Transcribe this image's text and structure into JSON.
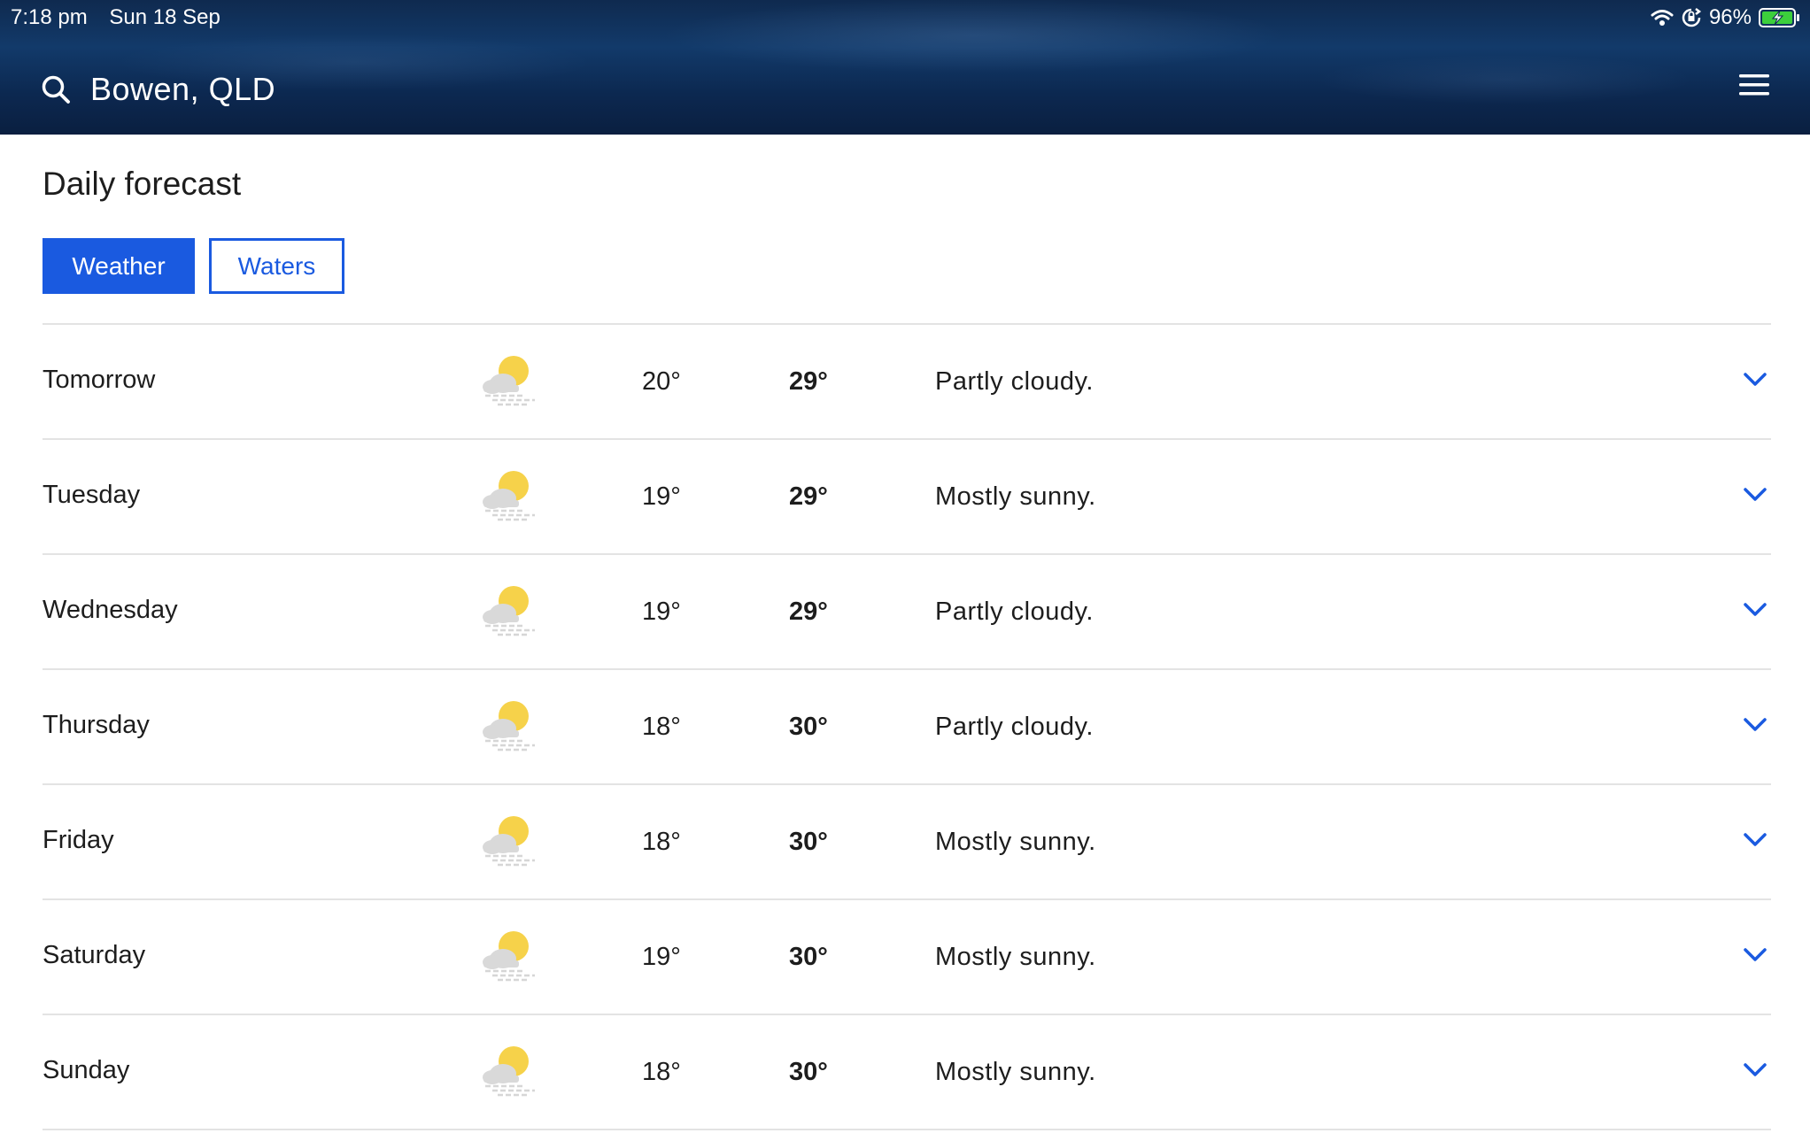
{
  "status": {
    "time": "7:18 pm",
    "date": "Sun 18 Sep",
    "battery": "96%"
  },
  "header": {
    "location": "Bowen, QLD"
  },
  "page": {
    "title": "Daily forecast"
  },
  "tabs": [
    {
      "label": "Weather",
      "active": true
    },
    {
      "label": "Waters",
      "active": false
    }
  ],
  "forecast": [
    {
      "day": "Tomorrow",
      "min": "20°",
      "max": "29°",
      "description": "Partly cloudy.",
      "icon": "partly-cloudy-icon"
    },
    {
      "day": "Tuesday",
      "min": "19°",
      "max": "29°",
      "description": "Mostly sunny.",
      "icon": "partly-cloudy-icon"
    },
    {
      "day": "Wednesday",
      "min": "19°",
      "max": "29°",
      "description": "Partly cloudy.",
      "icon": "partly-cloudy-icon"
    },
    {
      "day": "Thursday",
      "min": "18°",
      "max": "30°",
      "description": "Partly cloudy.",
      "icon": "partly-cloudy-icon"
    },
    {
      "day": "Friday",
      "min": "18°",
      "max": "30°",
      "description": "Mostly sunny.",
      "icon": "partly-cloudy-icon"
    },
    {
      "day": "Saturday",
      "min": "19°",
      "max": "30°",
      "description": "Mostly sunny.",
      "icon": "partly-cloudy-icon"
    },
    {
      "day": "Sunday",
      "min": "18°",
      "max": "30°",
      "description": "Mostly sunny.",
      "icon": "partly-cloudy-icon"
    }
  ],
  "colors": {
    "accent": "#1a5ae0",
    "header_bg": "#0f2a4f",
    "sun": "#f6d24a",
    "cloud": "#d9d9d9",
    "battery": "#3ccf3c"
  }
}
